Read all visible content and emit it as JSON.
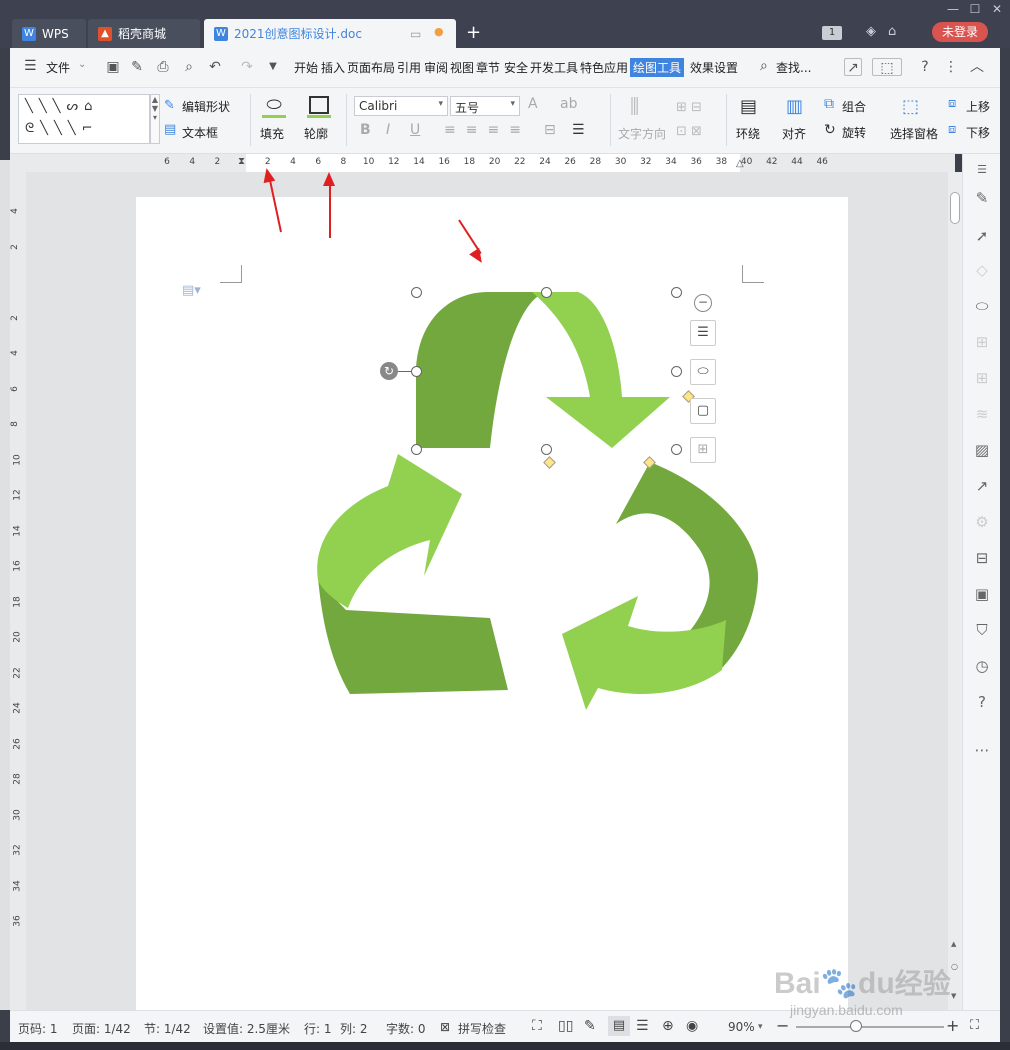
{
  "tabs": [
    {
      "label": "WPS"
    },
    {
      "label": "稻壳商城"
    },
    {
      "label": "2021创意图标设计.doc"
    }
  ],
  "title_right": {
    "badge": "1",
    "login": "未登录"
  },
  "menu": {
    "file": "文件",
    "items": [
      "开始",
      "插入",
      "页面布局",
      "引用",
      "审阅",
      "视图",
      "章节",
      "安全",
      "开发工具",
      "特色应用"
    ],
    "active": "绘图工具",
    "effects": "效果设置",
    "search": "查找..."
  },
  "ribbon": {
    "edit_shape": "编辑形状",
    "textbox": "文本框",
    "fill": "填充",
    "outline": "轮廓",
    "font": "Calibri",
    "size": "五号",
    "text_dir": "文字方向",
    "wrap": "环绕",
    "align": "对齐",
    "group": "组合",
    "rotate": "旋转",
    "select_pane": "选择窗格",
    "up": "上移",
    "down": "下移"
  },
  "ruler": {
    "h": [
      "6",
      "4",
      "2",
      "",
      "2",
      "4",
      "6",
      "8",
      "10",
      "12",
      "14",
      "16",
      "18",
      "20",
      "22",
      "24",
      "26",
      "28",
      "30",
      "32",
      "34",
      "36",
      "38",
      "40",
      "42",
      "44",
      "46"
    ],
    "v": [
      "4",
      "2",
      "",
      "2",
      "4",
      "6",
      "8",
      "10",
      "12",
      "14",
      "16",
      "18",
      "20",
      "22",
      "24",
      "26",
      "28",
      "30",
      "32",
      "34",
      "36"
    ]
  },
  "statusbar": {
    "pagenum": "页码: 1",
    "pages": "页面: 1/42",
    "section": "节: 1/42",
    "setting": "设置值: 2.5厘米",
    "row": "行: 1",
    "col": "列: 2",
    "words": "字数: 0",
    "spell": "拼写检查",
    "zoom": "90%"
  },
  "watermark": {
    "brand": "Bai",
    "brand2": "du",
    "cn": "经验",
    "url": "jingyan.baidu.com"
  },
  "colors": {
    "dark_green": "#72a83d",
    "light_green": "#92d050",
    "accent": "#3f85e0",
    "login": "#d9534f"
  }
}
